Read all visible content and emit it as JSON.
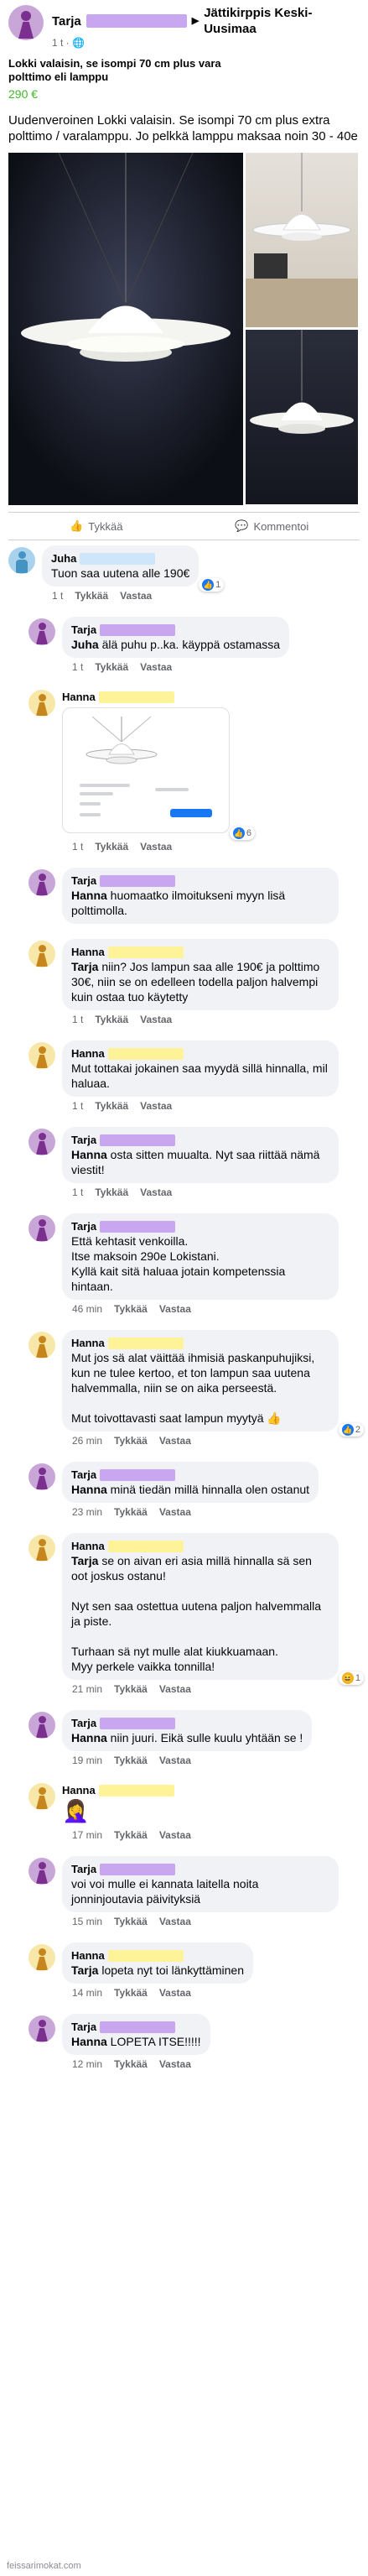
{
  "post": {
    "author": "Tarja",
    "group": "Jättikirppis Keski-Uusimaa",
    "time": "1 t",
    "title": "Lokki valaisin, se isompi 70 cm plus vara polttimo eli lamppu",
    "price": "290 €",
    "description": "Uudenveroinen Lokki valaisin. Se isompi 70 cm plus extra polttimo / varalamppu. Jo pelkkä lamppu maksaa noin 30 - 40e"
  },
  "actions": {
    "like": "Tykkää",
    "comment": "Kommentoi"
  },
  "comments": [
    {
      "author": "Juha",
      "avatar": "blue",
      "figure": "man",
      "reply": false,
      "text": "Tuon saa uutena alle 190€",
      "time": "1 t",
      "reaction": {
        "icon": "like",
        "count": "1"
      }
    },
    {
      "author": "Tarja",
      "avatar": "purple",
      "figure": "dress",
      "reply": true,
      "mention": "Juha",
      "text": " älä puhu p..ka. käyppä ostamassa",
      "time": "1 t"
    },
    {
      "author": "Hanna",
      "avatar": "yellow",
      "figure": "dress",
      "reply": true,
      "text": "",
      "image": true,
      "time": "1 t",
      "reaction": {
        "icon": "like",
        "count": "6"
      }
    },
    {
      "author": "Tarja",
      "avatar": "purple",
      "figure": "dress",
      "reply": true,
      "mention": "Hanna",
      "text": " huomaatko ilmoitukseni myyn lisä polttimolla.",
      "time": ""
    },
    {
      "author": "Hanna",
      "avatar": "yellow",
      "figure": "dress",
      "reply": true,
      "mention": "Tarja",
      "text": " niin? Jos lampun saa alle 190€ ja polttimo 30€, niin se on edelleen todella paljon halvempi kuin ostaa tuo käytetty",
      "time": "1 t"
    },
    {
      "author": "Hanna",
      "avatar": "yellow",
      "figure": "dress",
      "reply": true,
      "text": "Mut tottakai jokainen saa myydä sillä hinnalla, mil haluaa.",
      "time": "1 t"
    },
    {
      "author": "Tarja",
      "avatar": "purple",
      "figure": "dress",
      "reply": true,
      "mention": "Hanna",
      "text": " osta sitten muualta. Nyt saa riittää nämä viestit!",
      "time": "1 t"
    },
    {
      "author": "Tarja",
      "avatar": "purple",
      "figure": "dress",
      "reply": true,
      "text": "Että kehtasit venkoilla.\nItse maksoin 290e Lokistani.\nKyllä kait sitä haluaa jotain kompetenssia hintaan.",
      "time": "46 min"
    },
    {
      "author": "Hanna",
      "avatar": "yellow",
      "figure": "dress",
      "reply": true,
      "text": "Mut jos sä alat väittää ihmisiä paskanpuhujiksi, kun ne tulee kertoo, et ton lampun saa uutena halvemmalla, niin se on aika perseestä.\n\nMut toivottavasti saat lampun myytyä 👍",
      "time": "26 min",
      "reaction": {
        "icon": "like",
        "count": "2"
      }
    },
    {
      "author": "Tarja",
      "avatar": "purple",
      "figure": "dress",
      "reply": true,
      "mention": "Hanna",
      "text": " minä tiedän millä hinnalla olen ostanut",
      "time": "23 min"
    },
    {
      "author": "Hanna",
      "avatar": "yellow",
      "figure": "dress",
      "reply": true,
      "mention": "Tarja",
      "text": " se on aivan eri asia millä hinnalla sä sen oot joskus ostanu!\n\nNyt sen saa ostettua uutena paljon halvemmalla ja piste.\n\nTurhaan sä nyt mulle alat kiukkuamaan.\nMyy perkele vaikka tonnilla!",
      "time": "21 min",
      "reaction": {
        "icon": "haha",
        "count": "1"
      }
    },
    {
      "author": "Tarja",
      "avatar": "purple",
      "figure": "dress",
      "reply": true,
      "mention": "Hanna",
      "text": " niin juuri. Eikä sulle kuulu yhtään se !",
      "time": "19 min"
    },
    {
      "author": "Hanna",
      "avatar": "yellow",
      "figure": "dress",
      "reply": true,
      "text": "🤦‍♀️",
      "emoji_only": true,
      "time": "17 min"
    },
    {
      "author": "Tarja",
      "avatar": "purple",
      "figure": "dress",
      "reply": true,
      "text": "voi voi mulle ei kannata laitella noita jonninjoutavia päivityksiä",
      "time": "15 min"
    },
    {
      "author": "Hanna",
      "avatar": "yellow",
      "figure": "dress",
      "reply": true,
      "mention": "Tarja",
      "text": " lopeta nyt toi länkyttäminen",
      "time": "14 min"
    },
    {
      "author": "Tarja",
      "avatar": "purple",
      "figure": "dress",
      "reply": true,
      "mention": "Hanna",
      "text": " LOPETA ITSE!!!!!",
      "time": "12 min"
    }
  ],
  "labels": {
    "like": "Tykkää",
    "reply": "Vastaa"
  },
  "footer": "feissarimokat.com",
  "colors": {
    "price": "#42b72a",
    "highlight_purple": "#c8a6f0",
    "highlight_yellow": "#fff39a",
    "highlight_blue": "#cde6fa"
  }
}
